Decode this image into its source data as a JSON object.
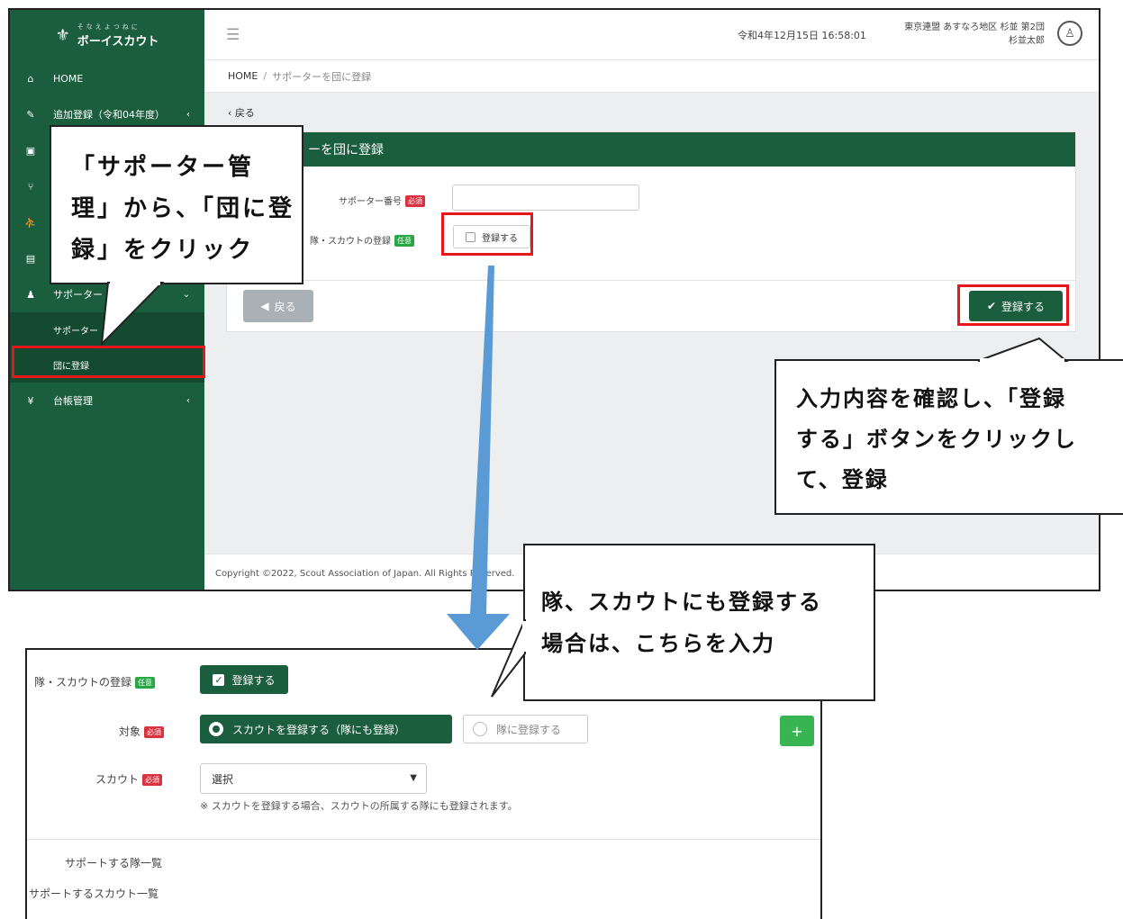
{
  "sidebar": {
    "logo_sub": "そなえよつねに",
    "logo_name": "ボーイスカウト",
    "items": [
      {
        "icon": "home-icon",
        "label": "HOME",
        "caret": ""
      },
      {
        "icon": "edit-icon",
        "label": "追加登録（令和04年度）",
        "caret": "‹"
      },
      {
        "icon": "id-card-icon",
        "label": "",
        "caret": ""
      },
      {
        "icon": "branch-icon",
        "label": "",
        "caret": ""
      },
      {
        "icon": "scout-icon",
        "label": "",
        "caret": ""
      },
      {
        "icon": "leader-icon",
        "label": "",
        "caret": ""
      },
      {
        "icon": "user-icon",
        "label": "サポーター",
        "caret": "⌄"
      }
    ],
    "sub_items": [
      {
        "label": "サポーター"
      },
      {
        "label": "団に登録"
      }
    ],
    "ledger": {
      "icon": "yen-icon",
      "label": "台帳管理",
      "caret": "‹"
    }
  },
  "header": {
    "menu_icon": "hamburger-icon",
    "datetime": "令和4年12月15日 16:58:01",
    "org": "東京連盟 あすなろ地区 杉並 第2団",
    "user": "杉並太郎",
    "avatar_icon": "user-avatar-icon"
  },
  "breadcrumb": {
    "home": "HOME",
    "sep": "/",
    "current": "サポーターを団に登録"
  },
  "page": {
    "back_link": "戻る",
    "card_title": "ーを団に登録",
    "supporter_no_label": "サポーター番号",
    "required_badge": "必須",
    "optional_badge": "任意",
    "unit_reg_label": "隊・スカウトの登録",
    "unit_reg_check": "登録する",
    "back_button": "戻る",
    "register_button": "登録する"
  },
  "footer": {
    "copyright": "Copyright ©2022, Scout Association of Japan. All Rights Reserved."
  },
  "detail": {
    "unit_reg_label": "隊・スカウトの登録",
    "optional_badge": "任意",
    "unit_reg_check": "登録する",
    "target_label": "対象",
    "required_badge": "必須",
    "target_option_1": "スカウトを登録する（隊にも登録）",
    "target_option_2": "隊に登録する",
    "add_button": "+",
    "scout_label": "スカウト",
    "select_value": "選択",
    "note": "※ スカウトを登録する場合、スカウトの所属する隊にも登録されます。",
    "support_units": "サポートする隊一覧",
    "support_scouts": "サポートするスカウト一覧"
  },
  "callouts": {
    "c1": [
      "「サポーター管",
      "理」から、「団に登",
      "録」をクリック"
    ],
    "c2": [
      "入力内容を確認し、「登録",
      "する」ボタンをクリックし",
      "て、登録"
    ],
    "c3": [
      "隊、スカウトにも登録する",
      "場合は、こちらを入力"
    ]
  },
  "colors": {
    "brand_green": "#1b5e3e",
    "highlight_red": "#e8151b",
    "arrow_blue": "#5b9bd5"
  }
}
